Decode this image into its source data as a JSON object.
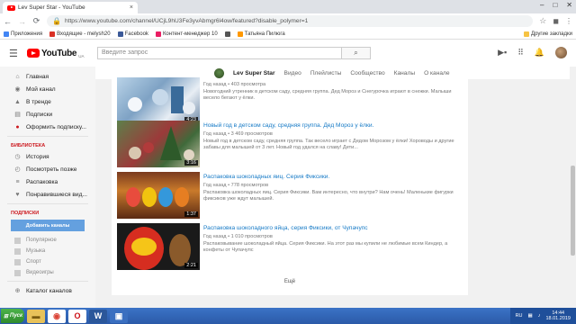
{
  "browser": {
    "tab_title": "Lev Super Star - YouTube",
    "tab_close": "×",
    "url": "https://www.youtube.com/channel/UCjL9hU3Fe3yvAbmgr6l4ow/featured?disable_polymer=1",
    "window_controls": [
      "–",
      "□",
      "✕"
    ],
    "bookmarks": [
      {
        "label": "Приложения",
        "color": "#4285f4"
      },
      {
        "label": "Входящие - melysh20",
        "color": "#d93025"
      },
      {
        "label": "Facebook",
        "color": "#3b5998"
      },
      {
        "label": "Контент-менеджер 10",
        "color": "#e91e63"
      },
      {
        "label": "",
        "color": "#555555"
      },
      {
        "label": "Татьяна Пилюга",
        "color": "#ff9800"
      }
    ],
    "other_bookmarks": "Другие закладки"
  },
  "masthead": {
    "logo_text": "YouTube",
    "logo_country": "UA",
    "search_placeholder": "Введите запрос",
    "search_icon": "search-icon"
  },
  "sidebar": {
    "items": [
      {
        "label": "Главная",
        "icon": "⌂"
      },
      {
        "label": "Мой канал",
        "icon": "◉"
      },
      {
        "label": "В тренде",
        "icon": "▲"
      },
      {
        "label": "Подписки",
        "icon": "▤"
      },
      {
        "label": "Оформить подписку...",
        "icon": "●"
      }
    ],
    "library_heading": "БИБЛИОТЕКА",
    "library": [
      {
        "label": "История",
        "icon": "◷"
      },
      {
        "label": "Посмотреть позже",
        "icon": "◴"
      },
      {
        "label": "Распаковка",
        "icon": "≡"
      },
      {
        "label": "Понравившиеся вид...",
        "icon": "♥"
      }
    ],
    "subs_heading": "ПОДПИСКИ",
    "add_channels": "Добавить каналы",
    "subs": [
      "Популярное",
      "Музыка",
      "Спорт",
      "Видеоигры"
    ],
    "catalog": "Каталог каналов"
  },
  "channel": {
    "name": "Lev Super Star",
    "tabs": [
      "Видео",
      "Плейлисты",
      "Сообщество",
      "Каналы",
      "О канале"
    ]
  },
  "videos": [
    {
      "title": "",
      "meta": "Год назад • 403 просмотра",
      "desc": "Новогодний утренник в детском саду, средняя группа. Дед Мороз и Снегурочка играют в снежки. Малыши весело бегают у ёлки.",
      "duration": "4:23"
    },
    {
      "title": "Новый год в детском саду, средняя группа. Дед Мороз у ёлки.",
      "meta": "Год назад • 3 469 просмотров",
      "desc": "Новый год в детском саду, средняя группа. Так весело играет с Дедом Морозом у ёлки! Хороводы и другие забавы для малышей от 3 лет. Новый год удался на славу! Дети...",
      "duration": "3:16"
    },
    {
      "title": "Распаковка шоколадных яиц. Серия Фиксики.",
      "meta": "Год назад • 778 просмотров",
      "desc": "Распаковка шоколадных яиц. Серия Фиксики. Вам интересно, что внутри? Нам очень! Маленькие фигурки фиксиков уже ждут малышей.",
      "duration": "1:37"
    },
    {
      "title": "Распаковка шоколадного яйца, серия Фиксики, от Чупачупс",
      "meta": "Год назад • 1 010 просмотров",
      "desc": "Распаковывание шоколадный яйца. Серия Фиксики. На этот раз мы купили не любимые всем Киндер, а конфеты от Чупачупс",
      "duration": "2:21"
    }
  ],
  "more_label": "Ещё",
  "taskbar": {
    "start_label": "Пуск",
    "lang": "RU",
    "time": "14:44",
    "date": "18.01.2019"
  }
}
